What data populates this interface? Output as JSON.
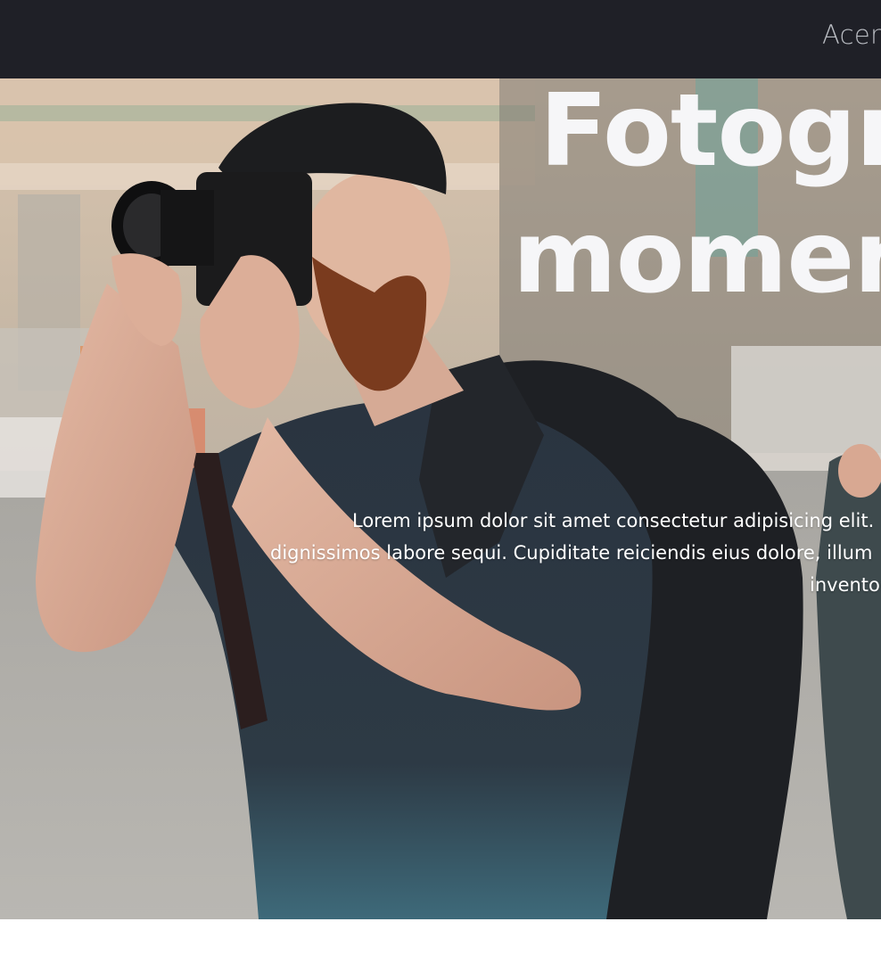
{
  "navbar": {
    "link_label": "Acerca"
  },
  "hero": {
    "title_line1": "Fotografía",
    "title_line2": "momentos",
    "text_line1": "Lorem ipsum dolor sit amet consectetur adipisicing elit.",
    "text_line2": "dignissimos labore sequi. Cupiditate reiciendis eius dolore, illum",
    "text_line3": "inventore"
  },
  "colors": {
    "navbar_bg": "#1f2027",
    "nav_text": "#b9bcc2",
    "hero_text": "#ffffff"
  }
}
